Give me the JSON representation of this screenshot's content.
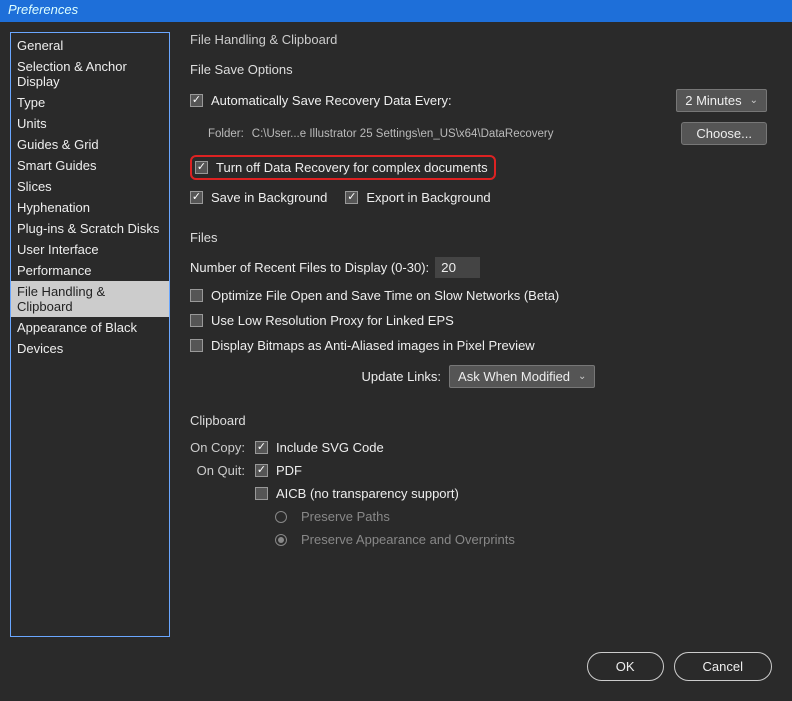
{
  "window": {
    "title": "Preferences"
  },
  "sidebar": {
    "items": [
      {
        "label": "General"
      },
      {
        "label": "Selection & Anchor Display"
      },
      {
        "label": "Type"
      },
      {
        "label": "Units"
      },
      {
        "label": "Guides & Grid"
      },
      {
        "label": "Smart Guides"
      },
      {
        "label": "Slices"
      },
      {
        "label": "Hyphenation"
      },
      {
        "label": "Plug-ins & Scratch Disks"
      },
      {
        "label": "User Interface"
      },
      {
        "label": "Performance"
      },
      {
        "label": "File Handling & Clipboard"
      },
      {
        "label": "Appearance of Black"
      },
      {
        "label": "Devices"
      }
    ],
    "selectedIndex": 11
  },
  "panel": {
    "title": "File Handling & Clipboard",
    "save": {
      "title": "File Save Options",
      "autoSave": {
        "checked": true,
        "label": "Automatically Save Recovery Data Every:"
      },
      "interval": {
        "value": "2 Minutes"
      },
      "folderLabel": "Folder:",
      "folderPath": "C:\\User...e Illustrator 25 Settings\\en_US\\x64\\DataRecovery",
      "chooseBtn": "Choose...",
      "turnOff": {
        "checked": true,
        "label": "Turn off Data Recovery for complex documents"
      },
      "saveBg": {
        "checked": true,
        "label": "Save in Background"
      },
      "exportBg": {
        "checked": true,
        "label": "Export in Background"
      }
    },
    "files": {
      "title": "Files",
      "recentLabel": "Number of Recent Files to Display (0-30):",
      "recentValue": "20",
      "optimize": {
        "checked": false,
        "label": "Optimize File Open and Save Time on Slow Networks (Beta)"
      },
      "lowRes": {
        "checked": false,
        "label": "Use Low Resolution Proxy for Linked EPS"
      },
      "bitmaps": {
        "checked": false,
        "label": "Display Bitmaps as Anti-Aliased images in Pixel Preview"
      },
      "updateLinksLabel": "Update Links:",
      "updateLinksValue": "Ask When Modified"
    },
    "clipboard": {
      "title": "Clipboard",
      "onCopyLabel": "On Copy:",
      "svg": {
        "checked": true,
        "label": "Include SVG Code"
      },
      "onQuitLabel": "On Quit:",
      "pdf": {
        "checked": true,
        "label": "PDF"
      },
      "aicb": {
        "checked": false,
        "label": "AICB (no transparency support)"
      },
      "preservePaths": "Preserve Paths",
      "preserveAppearance": "Preserve Appearance and Overprints"
    }
  },
  "footer": {
    "ok": "OK",
    "cancel": "Cancel"
  }
}
